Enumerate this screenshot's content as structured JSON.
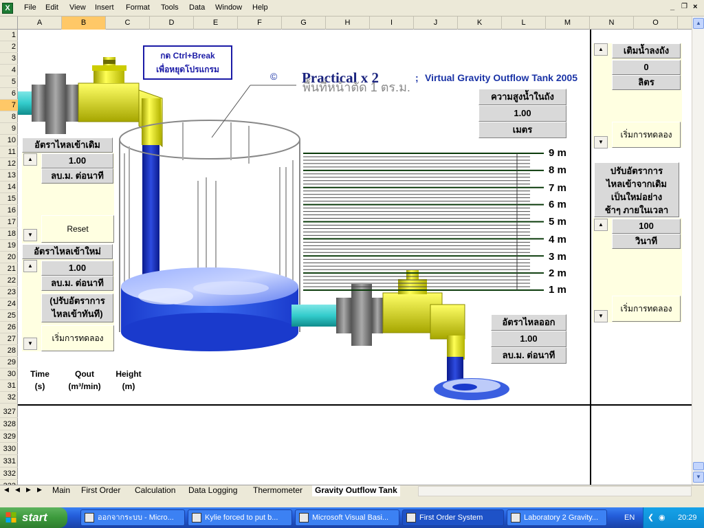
{
  "menu": {
    "items": [
      "File",
      "Edit",
      "View",
      "Insert",
      "Format",
      "Tools",
      "Data",
      "Window",
      "Help"
    ],
    "win_controls": [
      "_",
      "×"
    ]
  },
  "grid": {
    "columns": [
      "A",
      "B",
      "C",
      "D",
      "E",
      "F",
      "G",
      "H",
      "I",
      "J",
      "K",
      "L",
      "M",
      "N",
      "O"
    ],
    "active_column": "B",
    "rows": [
      "1",
      "2",
      "3",
      "4",
      "5",
      "6",
      "7",
      "8",
      "9",
      "10",
      "11",
      "12",
      "13",
      "14",
      "15",
      "16",
      "17",
      "18",
      "19",
      "20",
      "21",
      "22",
      "23",
      "24",
      "25",
      "26",
      "27",
      "28",
      "29",
      "30",
      "31",
      "32",
      "327",
      "328",
      "329",
      "330",
      "331",
      "332",
      "333"
    ],
    "active_row": "7"
  },
  "title": {
    "copyright": "©",
    "main": "Practical x 2",
    "semicolon": ";",
    "subtitle": "Virtual Gravity Outflow Tank 2005"
  },
  "ctrl_break": {
    "line1": "กด Ctrl+Break",
    "line2": "เพื่อหยุดโปรแกรม"
  },
  "area_label": "พื้นที่หน้าตัด 1 ตร.ม.",
  "inflow_initial": {
    "title": "อัตราไหลเข้าเดิม",
    "value": "1.00",
    "unit": "ลบ.ม. ต่อนาที",
    "reset": "Reset"
  },
  "inflow_new": {
    "title": "อัตราไหลเข้าใหม่",
    "value": "1.00",
    "unit": "ลบ.ม. ต่อนาที",
    "note_line1": "(ปรับอัตราการ",
    "note_line2": "ไหลเข้าทันที)",
    "start": "เริ่มการทดลอง"
  },
  "tank_height": {
    "title": "ความสูงน้ำในถัง",
    "value": "1.00",
    "unit": "เมตร",
    "level_m": 1.0,
    "max_m": 9
  },
  "scale": {
    "labels": [
      "9 m",
      "8 m",
      "7 m",
      "6 m",
      "5 m",
      "4 m",
      "3 m",
      "2 m",
      "1 m"
    ]
  },
  "outflow": {
    "title": "อัตราไหลออก",
    "value": "1.00",
    "unit": "ลบ.ม. ต่อนาที"
  },
  "add_water": {
    "title": "เติมน้ำลงถัง",
    "value": "0",
    "unit": "ลิตร",
    "start": "เริ่มการทดลอง"
  },
  "ramp": {
    "line1": "ปรับอัตราการ",
    "line2": "ไหลเข้าจากเดิม",
    "line3": "เป็นใหม่อย่าง",
    "line4": "ช้าๆ ภายในเวลา",
    "value": "100",
    "unit": "วินาที",
    "start": "เริ่มการทดลอง"
  },
  "columns_heads": {
    "time": "Time",
    "time_unit": "(s)",
    "qout": "Qout",
    "qout_unit": "(m³/min)",
    "height": "Height",
    "height_unit": "(m)"
  },
  "sheet_tabs": {
    "items": [
      "Main",
      "First Order",
      "Calculation",
      "Data Logging",
      "Thermometer",
      "Gravity Outflow Tank"
    ],
    "active": "Gravity Outflow Tank"
  },
  "taskbar": {
    "start": "start",
    "tasks": [
      "ออกจากระบบ - Micro...",
      "Kylie forced to put b...",
      "Microsoft Visual Basi...",
      "First Order System",
      "Laboratory 2 Gravity..."
    ],
    "active_task": "First Order System",
    "lang": "EN",
    "clock": "20:29"
  },
  "colors": {
    "water": "#2233bb",
    "pipe_cyan": "#33cccc",
    "valve_yellow": "#e6e600",
    "title_navy": "#1a237e"
  }
}
